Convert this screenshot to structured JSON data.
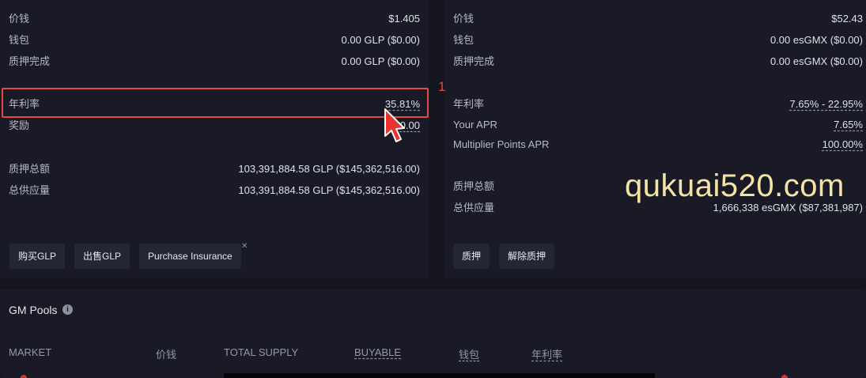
{
  "glp_panel": {
    "price_label": "价钱",
    "price_value": "$1.405",
    "wallet_label": "钱包",
    "wallet_value": "0.00 GLP ($0.00)",
    "staked_label": "质押完成",
    "staked_value": "0.00 GLP ($0.00)",
    "apr_label": "年利率",
    "apr_value": "35.81%",
    "rewards_label": "奖励",
    "rewards_value": "0.00",
    "total_staked_label": "质押总额",
    "total_staked_value": "103,391,884.58 GLP ($145,362,516.00)",
    "total_supply_label": "总供应量",
    "total_supply_value": "103,391,884.58 GLP ($145,362,516.00)",
    "buttons": {
      "buy": "购买GLP",
      "sell": "出售GLP",
      "insurance": "Purchase Insurance"
    }
  },
  "esgmx_panel": {
    "price_label": "价钱",
    "price_value": "$52.43",
    "wallet_label": "钱包",
    "wallet_value": "0.00 esGMX ($0.00)",
    "staked_label": "质押完成",
    "staked_value": "0.00 esGMX ($0.00)",
    "apr_label": "年利率",
    "apr_value": "7.65% - 22.95%",
    "your_apr_label": "Your APR",
    "your_apr_value": "7.65%",
    "mp_apr_label": "Multiplier Points APR",
    "mp_apr_value": "100.00%",
    "total_staked_label": "质押总额",
    "total_supply_label": "总供应量",
    "total_supply_value": "1,666,338 esGMX ($87,381,987)",
    "buttons": {
      "stake": "质押",
      "unstake": "解除质押"
    }
  },
  "annotation": {
    "number": "1"
  },
  "watermark": "qukuai520.com",
  "gm_pools": {
    "title": "GM Pools",
    "info_icon": "i",
    "columns": [
      "MARKET",
      "价钱",
      "TOTAL SUPPLY",
      "BUYABLE",
      "钱包",
      "年利率"
    ]
  },
  "colors": {
    "highlight": "#e24a45",
    "background": "#14151f",
    "panel": "#191a26",
    "watermark": "#f3e3a6"
  }
}
